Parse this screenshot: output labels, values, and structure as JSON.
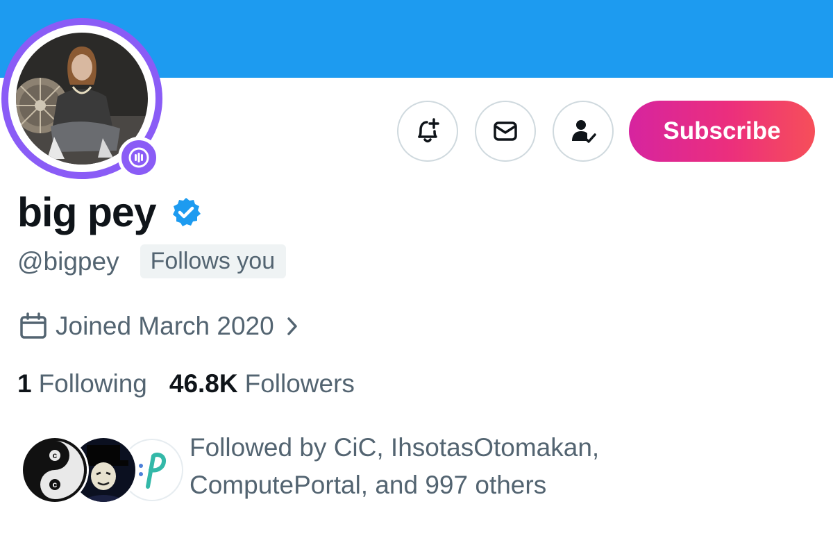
{
  "profile": {
    "display_name": "big pey",
    "handle": "@bigpey",
    "follows_you": "Follows you",
    "joined": "Joined March 2020",
    "following_count": "1",
    "following_label": "Following",
    "followers_count": "46.8K",
    "followers_label": "Followers",
    "followed_by": "Followed by CiC, IhsotasOtomakan, ComputePortal, and 997 others"
  },
  "actions": {
    "subscribe_label": "Subscribe",
    "icons": [
      "bell-plus-icon",
      "envelope-icon",
      "person-check-icon"
    ]
  },
  "colors": {
    "banner": "#1d9bf0",
    "avatar_ring": "#8a5cf6",
    "verified": "#1d9bf0",
    "subscribe_start": "#d6249f",
    "subscribe_end": "#f64f59",
    "secondary_text": "#536471"
  }
}
